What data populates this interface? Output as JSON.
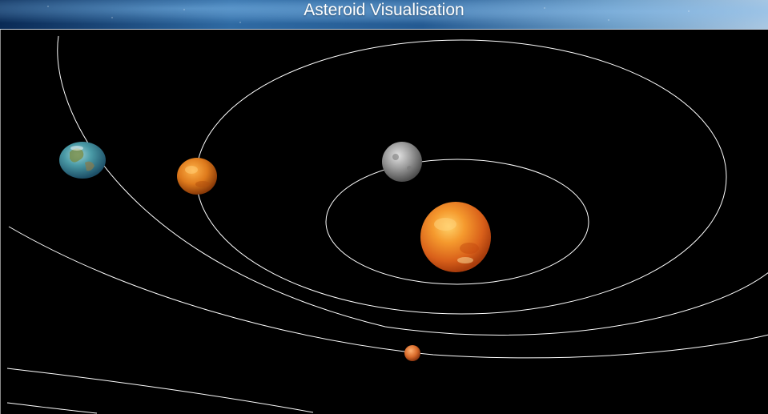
{
  "header": {
    "title": "Asteroid Visualisation"
  },
  "scene": {
    "background_color": "#000000",
    "orbit_color": "#ffffff",
    "bodies": [
      {
        "name": "sun",
        "icon": "sun-icon",
        "color": "#e8781a"
      },
      {
        "name": "mercury",
        "icon": "mercury-icon",
        "color": "#9a9a9a"
      },
      {
        "name": "venus",
        "icon": "venus-icon",
        "color": "#d97b1e"
      },
      {
        "name": "earth",
        "icon": "earth-icon",
        "color": "#3f8fa0"
      },
      {
        "name": "mars",
        "icon": "mars-icon",
        "color": "#d06a2a"
      }
    ]
  }
}
